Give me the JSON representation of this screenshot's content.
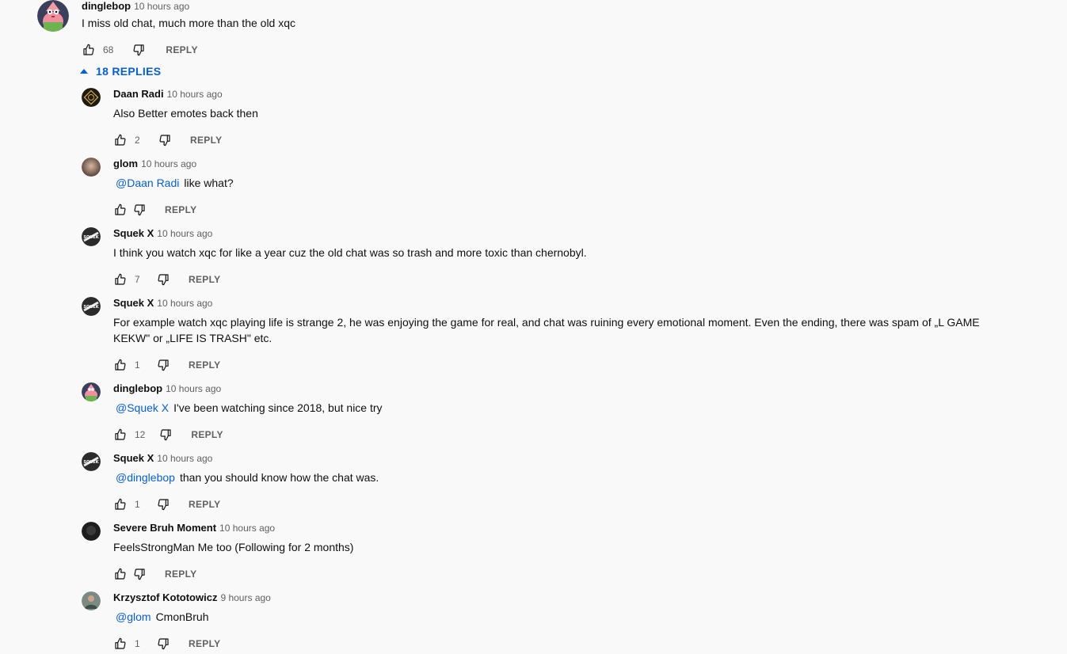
{
  "top_comment": {
    "author": "dinglebop",
    "time": "10 hours ago",
    "text": "I miss old chat, much more than the old xqc",
    "likes": "68",
    "reply_label": "REPLY"
  },
  "replies_toggle": {
    "label": "18 REPLIES"
  },
  "replies": [
    {
      "author": "Daan Radi",
      "time": "10 hours ago",
      "mention": "",
      "text": "Also Better emotes back then",
      "likes": "2",
      "reply_label": "REPLY",
      "avatar": "gold-emblem"
    },
    {
      "author": "glom",
      "time": "10 hours ago",
      "mention": "@Daan Radi",
      "text": "like what?",
      "likes": "",
      "reply_label": "REPLY",
      "avatar": "blur-photo"
    },
    {
      "author": "Squek X",
      "time": "10 hours ago",
      "mention": "",
      "text": "I think you watch xqc for like a year cuz the old chat was so trash and more toxic than chernobyl.",
      "likes": "7",
      "reply_label": "REPLY",
      "avatar": "dark-logo"
    },
    {
      "author": "Squek X",
      "time": "10 hours ago",
      "mention": "",
      "text": "For example watch xqc playing life is strange 2, he was enjoying the game for real, and chat was ruining every emotional moment. Even the ending, there was spam of „L GAME KEKW\" or „LIFE IS TRASH\" etc.",
      "likes": "1",
      "reply_label": "REPLY",
      "avatar": "dark-logo"
    },
    {
      "author": "dinglebop",
      "time": "10 hours ago",
      "mention": "@Squek X",
      "text": "I've been watching since 2018, but nice try",
      "likes": "12",
      "reply_label": "REPLY",
      "avatar": "patrick"
    },
    {
      "author": "Squek X",
      "time": "10 hours ago",
      "mention": "@dinglebop",
      "text": "than you should know how the chat was.",
      "likes": "1",
      "reply_label": "REPLY",
      "avatar": "dark-logo"
    },
    {
      "author": "Severe Bruh Moment",
      "time": "10 hours ago",
      "mention": "",
      "text": "FeelsStrongMan Me too (Following for 2 months)",
      "likes": "",
      "reply_label": "REPLY",
      "avatar": "dark-circle"
    },
    {
      "author": "Krzysztof Kototowicz",
      "time": "9 hours ago",
      "mention": "@glom",
      "text": "CmonBruh",
      "likes": "1",
      "reply_label": "REPLY",
      "avatar": "person-photo"
    }
  ],
  "colors": {
    "link": "#065fd4",
    "meta": "#606060",
    "background": "#f9f9f9"
  }
}
